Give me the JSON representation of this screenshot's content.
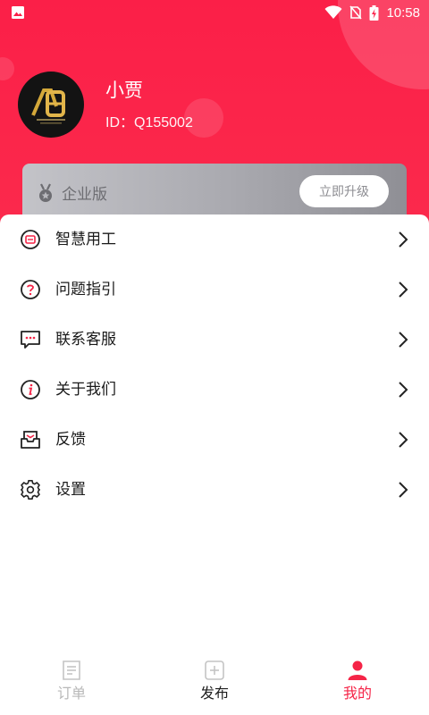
{
  "status_bar": {
    "time": "10:58",
    "icons": [
      "image-icon",
      "wifi-icon",
      "no-sim-icon",
      "battery-charging-icon"
    ]
  },
  "colors": {
    "brand": "#fb1f48",
    "active_tab": "#f52447",
    "card_gray": "#a9a9af"
  },
  "profile": {
    "name": "小贾",
    "id": "ID：Q155002",
    "avatar_icon": "company-logo"
  },
  "vip": {
    "icon": "medal-icon",
    "label": "企业版",
    "button": "立即升级"
  },
  "menu": [
    {
      "label": "智慧用工",
      "icon": "smart-work-icon"
    },
    {
      "label": "问题指引",
      "icon": "question-icon"
    },
    {
      "label": "联系客服",
      "icon": "chat-icon"
    },
    {
      "label": "关于我们",
      "icon": "info-icon"
    },
    {
      "label": "反馈",
      "icon": "mail-tray-icon"
    },
    {
      "label": "设置",
      "icon": "gear-icon"
    }
  ],
  "tabs": [
    {
      "label": "订单",
      "icon": "order-icon",
      "state": "inactive"
    },
    {
      "label": "发布",
      "icon": "add-square-icon",
      "state": "inactive"
    },
    {
      "label": "我的",
      "icon": "user-icon",
      "state": "active"
    }
  ]
}
